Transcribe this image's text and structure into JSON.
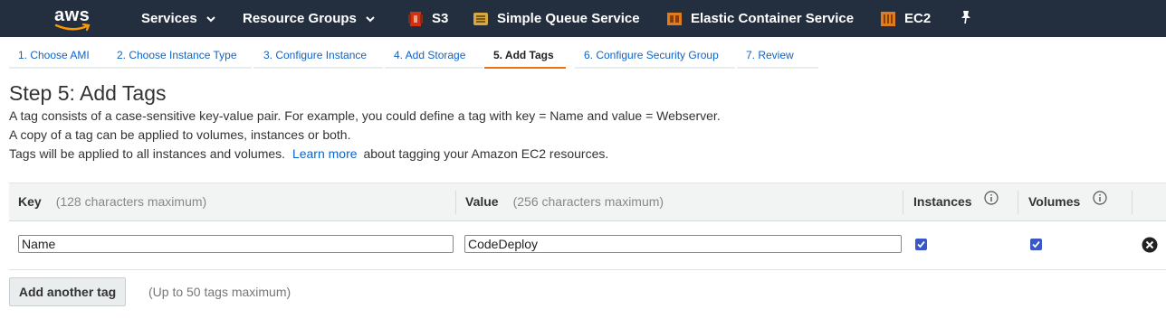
{
  "topnav": {
    "logo_text": "aws",
    "items": [
      {
        "label": "Services",
        "icon": "chevron-down-icon"
      },
      {
        "label": "Resource Groups",
        "icon": "chevron-down-icon"
      },
      {
        "label": "S3",
        "icon": "s3-icon",
        "color": "#d13212"
      },
      {
        "label": "Simple Queue Service",
        "icon": "sqs-icon",
        "color": "#d9a741"
      },
      {
        "label": "Elastic Container Service",
        "icon": "ecs-icon",
        "color": "#e07b1f"
      },
      {
        "label": "EC2",
        "icon": "ec2-icon",
        "color": "#e07b1f"
      }
    ],
    "pin_icon": "pin-icon"
  },
  "wizard": {
    "steps": [
      {
        "label": "1. Choose AMI"
      },
      {
        "label": "2. Choose Instance Type"
      },
      {
        "label": "3. Configure Instance"
      },
      {
        "label": "4. Add Storage"
      },
      {
        "label": "5. Add Tags",
        "active": true
      },
      {
        "label": "6. Configure Security Group"
      },
      {
        "label": "7. Review"
      }
    ]
  },
  "page": {
    "title": "Step 5: Add Tags",
    "line1": "A tag consists of a case-sensitive key-value pair. For example, you could define a tag with key = Name and value = Webserver.",
    "line2": "A copy of a tag can be applied to volumes, instances or both.",
    "line3_prefix": "Tags will be applied to all instances and volumes.",
    "line3_link": "Learn more",
    "line3_suffix": "about tagging your Amazon EC2 resources."
  },
  "table": {
    "headers": {
      "key": "Key",
      "key_hint": "(128 characters maximum)",
      "value": "Value",
      "value_hint": "(256 characters maximum)",
      "instances": "Instances",
      "volumes": "Volumes"
    },
    "rows": [
      {
        "key": "Name",
        "value": "CodeDeploy",
        "instances": true,
        "volumes": true
      }
    ]
  },
  "actions": {
    "add_button": "Add another tag",
    "add_hint": "(Up to 50 tags maximum)"
  },
  "colors": {
    "nav_bg": "#232f3e",
    "link": "#0d64c8",
    "active_step": "#ec7211",
    "checkbox": "#3b56c8"
  }
}
